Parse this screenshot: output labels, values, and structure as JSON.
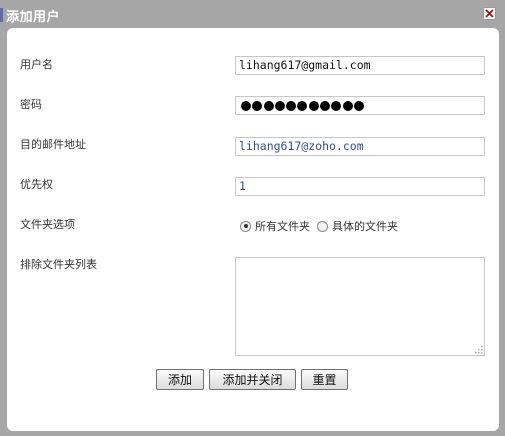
{
  "dialog": {
    "title": "添加用户",
    "close_icon": "close-icon"
  },
  "form": {
    "username": {
      "label": "用户名",
      "value": "lihang617@gmail.com"
    },
    "password": {
      "label": "密码",
      "masked_length": 11
    },
    "destination": {
      "label": "目的邮件地址",
      "value": "lihang617@zoho.com"
    },
    "priority": {
      "label": "优先权",
      "value": "1"
    },
    "folder_option": {
      "label": "文件夹选项",
      "options": [
        "所有文件夹",
        "具体的文件夹"
      ],
      "selected": "所有文件夹"
    },
    "exclude_list": {
      "label": "排除文件夹列表",
      "value": ""
    }
  },
  "buttons": {
    "add": "添加",
    "add_close": "添加并关闭",
    "reset": "重置"
  }
}
